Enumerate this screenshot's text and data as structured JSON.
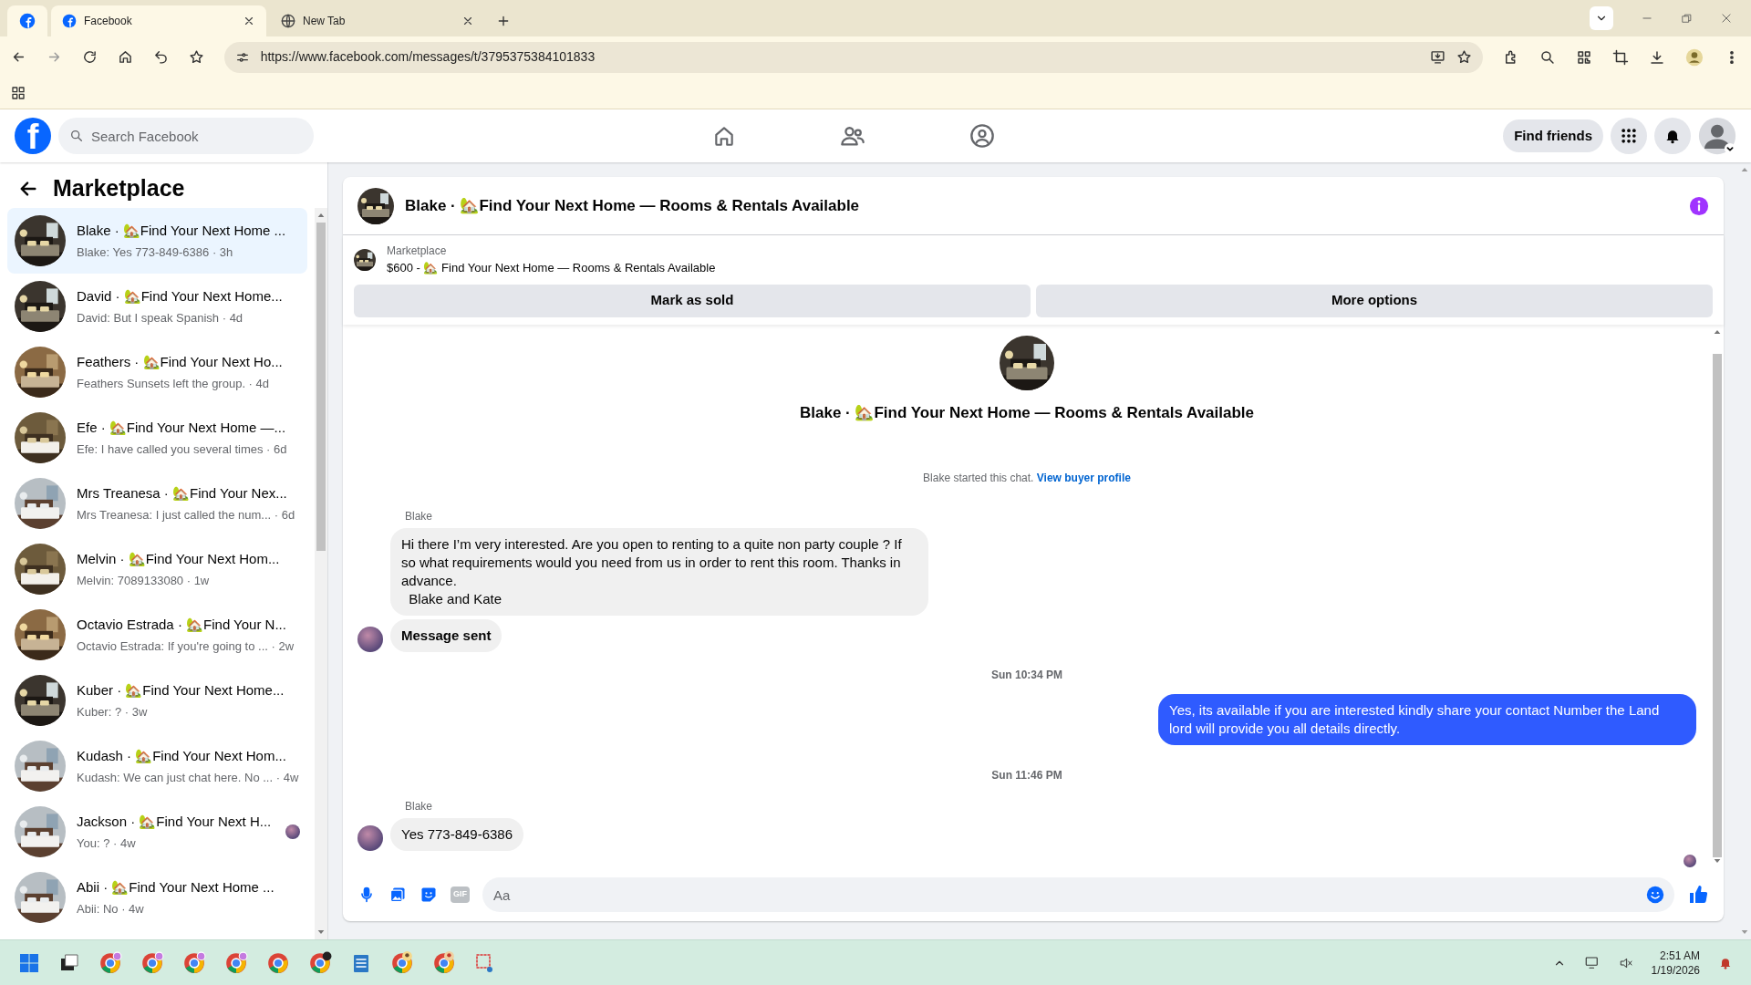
{
  "browser": {
    "tabs": [
      {
        "label": "Facebook",
        "selected": true
      },
      {
        "label": "New Tab",
        "selected": false
      }
    ],
    "url": "https://www.facebook.com/messages/t/3795375384101833"
  },
  "header": {
    "logo_letter": "f",
    "search_placeholder": "Search Facebook",
    "find_friends": "Find friends"
  },
  "sidebar": {
    "title": "Marketplace",
    "items": [
      {
        "name": "Blake · 🏡Find Your Next Home ...",
        "preview": "Blake: Yes 773-849-6386 · 3h",
        "selected": true,
        "seen": false
      },
      {
        "name": "David · 🏡Find Your Next Home...",
        "preview": "David: But I speak Spanish · 4d",
        "selected": false,
        "seen": false
      },
      {
        "name": "Feathers · 🏡Find Your Next Ho...",
        "preview": "Feathers Sunsets left the group. · 4d",
        "selected": false,
        "seen": false
      },
      {
        "name": "Efe · 🏡Find Your Next Home —...",
        "preview": "Efe: I have called you several times · 6d",
        "selected": false,
        "seen": false
      },
      {
        "name": "Mrs Treanesa · 🏡Find Your Nex...",
        "preview": "Mrs Treanesa: I just called the num...  · 6d",
        "selected": false,
        "seen": false
      },
      {
        "name": "Melvin · 🏡Find Your Next Hom...",
        "preview": "Melvin: 7089133080 · 1w",
        "selected": false,
        "seen": false
      },
      {
        "name": "Octavio Estrada · 🏡Find Your N...",
        "preview": "Octavio Estrada: If you're going to ... · 2w",
        "selected": false,
        "seen": false
      },
      {
        "name": "Kuber · 🏡Find Your Next Home...",
        "preview": "Kuber: ? · 3w",
        "selected": false,
        "seen": false
      },
      {
        "name": "Kudash · 🏡Find Your Next Hom...",
        "preview": "Kudash: We can just chat here. No ... · 4w",
        "selected": false,
        "seen": false
      },
      {
        "name": "Jackson · 🏡Find Your Next H...",
        "preview": "You: ? · 4w",
        "selected": false,
        "seen": true
      },
      {
        "name": "Abii · 🏡Find Your Next Home ...",
        "preview": "Abii: No · 4w",
        "selected": false,
        "seen": false
      }
    ]
  },
  "chat": {
    "title": "Blake · 🏡Find Your Next Home — Rooms & Rentals Available",
    "listing": {
      "label": "Marketplace",
      "detail": "$600 - 🏡 Find Your Next Home — Rooms & Rentals Available"
    },
    "buttons": [
      "Mark as sold",
      "More options"
    ],
    "intro_title": "Blake · 🏡Find Your Next Home — Rooms & Rentals Available",
    "messages": [
      {
        "kind": "notice",
        "text": "Blake started this chat.",
        "link": "View buyer profile"
      },
      {
        "kind": "sender",
        "text": "Blake"
      },
      {
        "kind": "incoming",
        "text": "Hi there I’m very interested. Are you open to renting to a quite non party couple ? If so what requirements would you need from us in order to rent this room. Thanks in advance.\n  Blake and Kate",
        "avatar": false,
        "bold": false
      },
      {
        "kind": "incoming",
        "text": "Message sent",
        "avatar": true,
        "bold": true
      },
      {
        "kind": "time",
        "text": "Sun 10:34 PM"
      },
      {
        "kind": "outgoing",
        "text": "Yes, its available if you are interested kindly share your contact Number the Land lord will provide you all details directly."
      },
      {
        "kind": "time",
        "text": "Sun 11:46 PM"
      },
      {
        "kind": "sender",
        "text": "Blake"
      },
      {
        "kind": "incoming",
        "text": "Yes 773-849-6386",
        "avatar": true,
        "bold": false
      }
    ],
    "seen_receipt": true,
    "composer": {
      "placeholder": "Aa",
      "gif": "GIF"
    }
  },
  "taskbar": {
    "time": "2:51 AM",
    "date": "1/19/2026"
  }
}
